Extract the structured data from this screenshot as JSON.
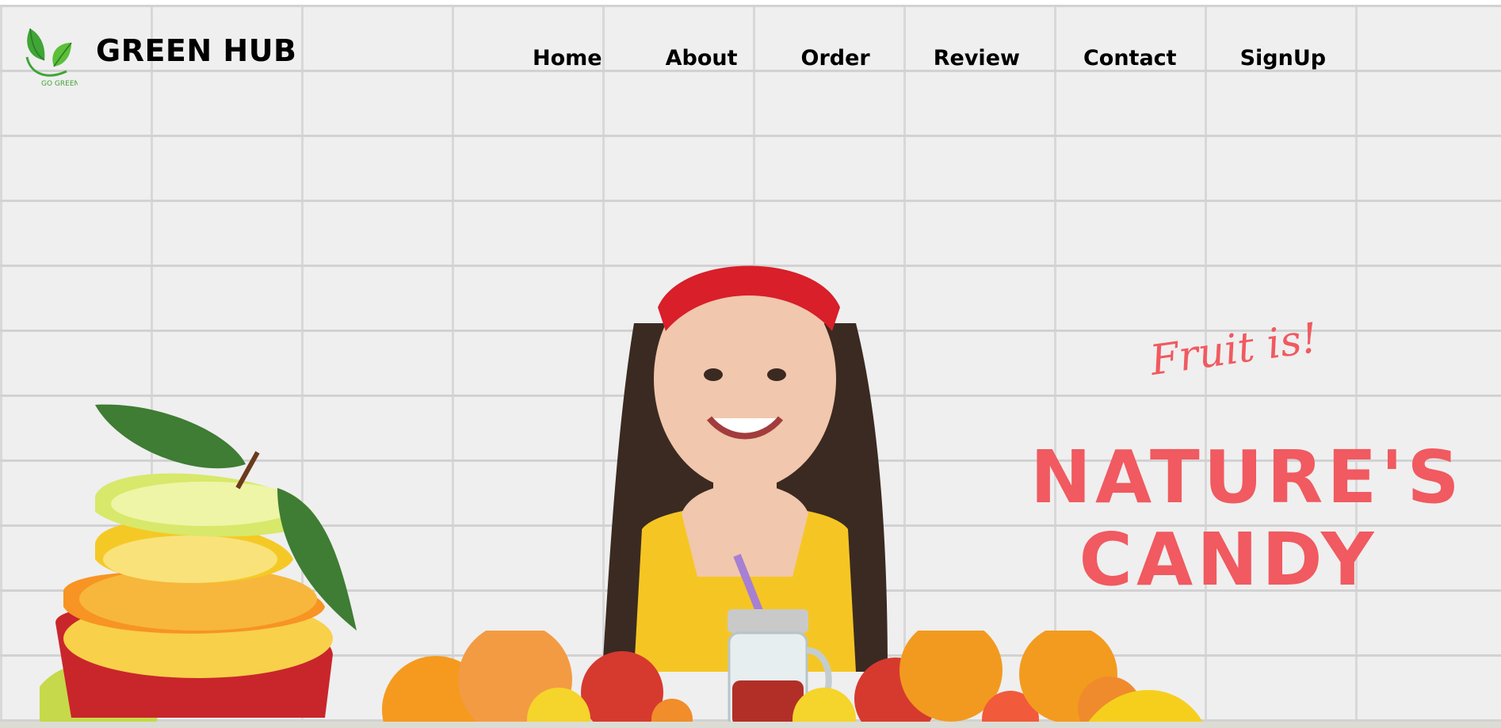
{
  "header": {
    "brand_name": "GREEN HUB",
    "logo_text": "GO GREEN",
    "logo_icon": "leaf-icon"
  },
  "nav": {
    "items": [
      {
        "label": "Home"
      },
      {
        "label": "About"
      },
      {
        "label": "Order"
      },
      {
        "label": "Review"
      },
      {
        "label": "Contact"
      },
      {
        "label": "SignUp"
      }
    ]
  },
  "hero": {
    "tagline": "Fruit is!",
    "headline_line1": "NATURE'S",
    "headline_line2": "CANDY",
    "accent_color": "#f05a60",
    "slider_icon": "chevron-left-icon"
  },
  "colors": {
    "brand_green": "#3fa535",
    "wall": "#efefef",
    "text": "#000000"
  }
}
